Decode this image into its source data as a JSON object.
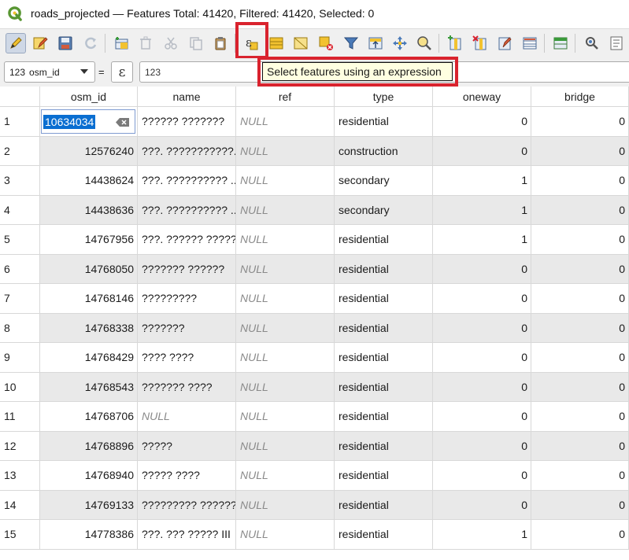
{
  "window": {
    "title": "roads_projected — Features Total: 41420, Filtered: 41420, Selected: 0"
  },
  "toolbar": {
    "buttons": [
      {
        "icon": "pencil-icon",
        "name": "toggle-editing"
      },
      {
        "icon": "multi-edit-icon",
        "name": "multi-edit"
      },
      {
        "icon": "save-edits-icon",
        "name": "save-edits"
      },
      {
        "icon": "reload-icon",
        "name": "reload"
      },
      {
        "icon": "add-feature-icon",
        "name": "add-feature"
      },
      {
        "icon": "delete-feature-icon",
        "name": "delete-selected"
      },
      {
        "icon": "cut-icon",
        "name": "cut"
      },
      {
        "icon": "copy-icon",
        "name": "copy"
      },
      {
        "icon": "paste-icon",
        "name": "paste"
      },
      {
        "icon": "select-by-expression-icon",
        "name": "select-by-expression"
      },
      {
        "icon": "select-all-icon",
        "name": "select-all"
      },
      {
        "icon": "invert-selection-icon",
        "name": "invert-selection"
      },
      {
        "icon": "deselect-all-icon",
        "name": "deselect-all"
      },
      {
        "icon": "filter-icon",
        "name": "filter-select"
      },
      {
        "icon": "move-to-top-icon",
        "name": "move-selection-top"
      },
      {
        "icon": "pan-to-selection-icon",
        "name": "pan-to-selection"
      },
      {
        "icon": "zoom-to-selection-icon",
        "name": "zoom-to-selection"
      },
      {
        "icon": "new-field-icon",
        "name": "new-field"
      },
      {
        "icon": "delete-field-icon",
        "name": "delete-field"
      },
      {
        "icon": "field-calculator-icon",
        "name": "open-field-calculator"
      },
      {
        "icon": "conditional-formatting-icon",
        "name": "conditional-formatting"
      },
      {
        "icon": "dock-icon",
        "name": "dock-table"
      },
      {
        "icon": "actions-icon",
        "name": "actions"
      },
      {
        "icon": "form-view-icon",
        "name": "form-view"
      }
    ],
    "accent_highlight": "#d9232e"
  },
  "tooltip": {
    "text": "Select features using an expression"
  },
  "expression_bar": {
    "field_type": "123",
    "field_name": "osm_id",
    "operator": "=",
    "epsilon_symbol": "ε",
    "value_type": "123"
  },
  "table": {
    "columns": [
      "osm_id",
      "name",
      "ref",
      "type",
      "oneway",
      "bridge"
    ],
    "rows": [
      {
        "n": "1",
        "osm_id": "10634034",
        "name": "?????? ???????",
        "ref": "NULL",
        "type": "residential",
        "oneway": "0",
        "bridge": "0"
      },
      {
        "n": "2",
        "osm_id": "12576240",
        "name": "???. ???????????...",
        "ref": "NULL",
        "type": "construction",
        "oneway": "0",
        "bridge": "0"
      },
      {
        "n": "3",
        "osm_id": "14438624",
        "name": "???. ?????????? ...",
        "ref": "NULL",
        "type": "secondary",
        "oneway": "1",
        "bridge": "0"
      },
      {
        "n": "4",
        "osm_id": "14438636",
        "name": "???. ?????????? ...",
        "ref": "NULL",
        "type": "secondary",
        "oneway": "1",
        "bridge": "0"
      },
      {
        "n": "5",
        "osm_id": "14767956",
        "name": "???. ?????? ??????",
        "ref": "NULL",
        "type": "residential",
        "oneway": "1",
        "bridge": "0"
      },
      {
        "n": "6",
        "osm_id": "14768050",
        "name": "??????? ??????",
        "ref": "NULL",
        "type": "residential",
        "oneway": "0",
        "bridge": "0"
      },
      {
        "n": "7",
        "osm_id": "14768146",
        "name": "?????????",
        "ref": "NULL",
        "type": "residential",
        "oneway": "0",
        "bridge": "0"
      },
      {
        "n": "8",
        "osm_id": "14768338",
        "name": "???????",
        "ref": "NULL",
        "type": "residential",
        "oneway": "0",
        "bridge": "0"
      },
      {
        "n": "9",
        "osm_id": "14768429",
        "name": "???? ????",
        "ref": "NULL",
        "type": "residential",
        "oneway": "0",
        "bridge": "0"
      },
      {
        "n": "10",
        "osm_id": "14768543",
        "name": "??????? ????",
        "ref": "NULL",
        "type": "residential",
        "oneway": "0",
        "bridge": "0"
      },
      {
        "n": "11",
        "osm_id": "14768706",
        "name": "NULL",
        "ref": "NULL",
        "type": "residential",
        "oneway": "0",
        "bridge": "0"
      },
      {
        "n": "12",
        "osm_id": "14768896",
        "name": "?????",
        "ref": "NULL",
        "type": "residential",
        "oneway": "0",
        "bridge": "0"
      },
      {
        "n": "13",
        "osm_id": "14768940",
        "name": "????? ????",
        "ref": "NULL",
        "type": "residential",
        "oneway": "0",
        "bridge": "0"
      },
      {
        "n": "14",
        "osm_id": "14769133",
        "name": "????????? ??????",
        "ref": "NULL",
        "type": "residential",
        "oneway": "0",
        "bridge": "0"
      },
      {
        "n": "15",
        "osm_id": "14778386",
        "name": "???. ??? ????? III",
        "ref": "NULL",
        "type": "residential",
        "oneway": "1",
        "bridge": "0"
      }
    ]
  }
}
